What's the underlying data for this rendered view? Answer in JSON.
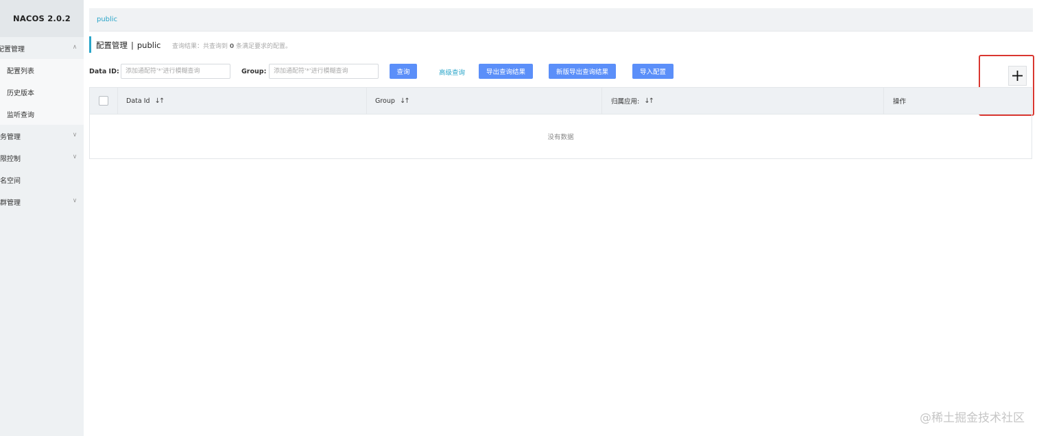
{
  "app": {
    "brand": "NACOS 2.0.2"
  },
  "sidebar": {
    "items": [
      {
        "label": "配置管理",
        "chevron": "∧"
      },
      {
        "label": "配置列表"
      },
      {
        "label": "历史版本"
      },
      {
        "label": "监听查询"
      },
      {
        "label": "服务管理",
        "chevron": "∨"
      },
      {
        "label": "权限控制",
        "chevron": "∨"
      },
      {
        "label": "命名空间"
      },
      {
        "label": "集群管理",
        "chevron": "∨"
      }
    ]
  },
  "breadcrumb": {
    "namespace": "public"
  },
  "title": {
    "section": "配置管理",
    "separator": "|",
    "namespace": "public"
  },
  "result_hint": {
    "prefix": "查询结果：共查询到",
    "count": "0",
    "suffix": "条满足要求的配置。"
  },
  "filters": {
    "data_id_label": "Data ID:",
    "data_id_placeholder": "添加通配符'*'进行模糊查询",
    "group_label": "Group:",
    "group_placeholder": "添加通配符'*'进行模糊查询",
    "query_button": "查询",
    "advanced_query": "高级查询",
    "export_button": "导出查询结果",
    "export_new_button": "新版导出查询结果",
    "import_button": "导入配置"
  },
  "table": {
    "columns": [
      {
        "label": "Data Id",
        "sortable": true
      },
      {
        "label": "Group",
        "sortable": true
      },
      {
        "label": "归属应用:",
        "sortable": true
      },
      {
        "label": "操作",
        "sortable": false
      }
    ],
    "empty_text": "没有数据"
  },
  "watermark": "@稀土掘金技术社区",
  "colors": {
    "accent": "#2aa5c9",
    "primary_button": "#5b8ff9",
    "highlight": "#d9362f"
  }
}
